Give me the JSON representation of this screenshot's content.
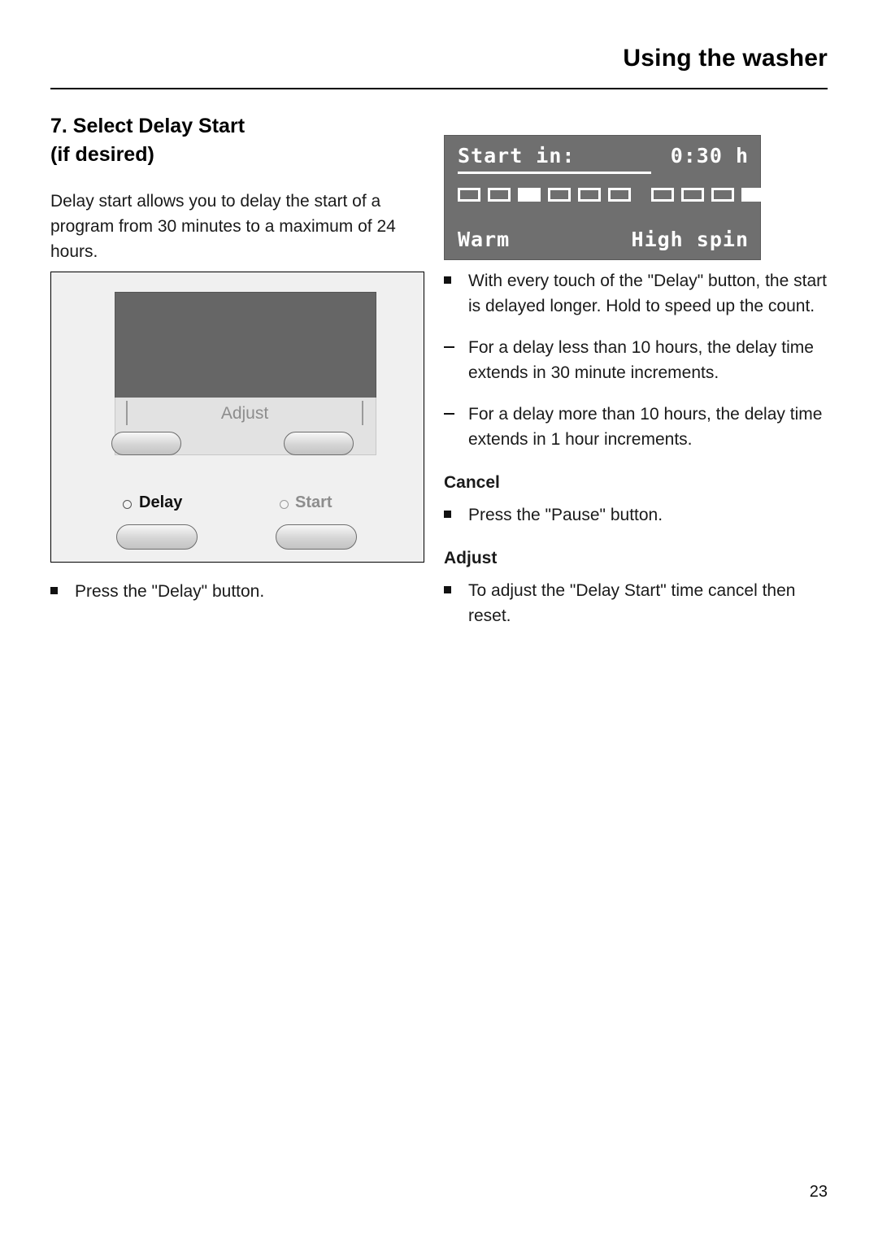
{
  "header": {
    "title": "Using the washer"
  },
  "left": {
    "heading_line1": "7. Select Delay Start",
    "heading_line2": "(if desired)",
    "intro": "Delay start allows you to delay the start of a program from 30 minutes to a maximum of 24 hours.",
    "caption": "Press the \"Delay\" button."
  },
  "panel": {
    "adjust_label": "Adjust",
    "delay_label": "Delay",
    "start_label": "Start"
  },
  "lcd": {
    "start_in": "Start in:",
    "time": "0:30 h",
    "temperature": "Warm",
    "spin": "High spin",
    "segments": [
      "outline",
      "outline",
      "filled",
      "outline",
      "outline",
      "outline",
      "outline",
      "outline",
      "outline",
      "filled",
      "outline"
    ]
  },
  "right": {
    "bullets": [
      {
        "marker": "square",
        "text": "With every touch of the \"Delay\" button, the start is delayed longer. Hold to speed up the count."
      },
      {
        "marker": "dash",
        "text": "For a delay less than 10 hours, the delay time extends in 30 minute increments."
      },
      {
        "marker": "dash",
        "text": "For a delay more than 10 hours, the delay time extends in 1 hour increments."
      }
    ],
    "cancel_heading": "Cancel",
    "cancel_text": "Press the \"Pause\" button.",
    "adjust_heading": "Adjust",
    "adjust_text": "To adjust the \"Delay Start\" time cancel then reset."
  },
  "footer": {
    "page_number": "23"
  }
}
